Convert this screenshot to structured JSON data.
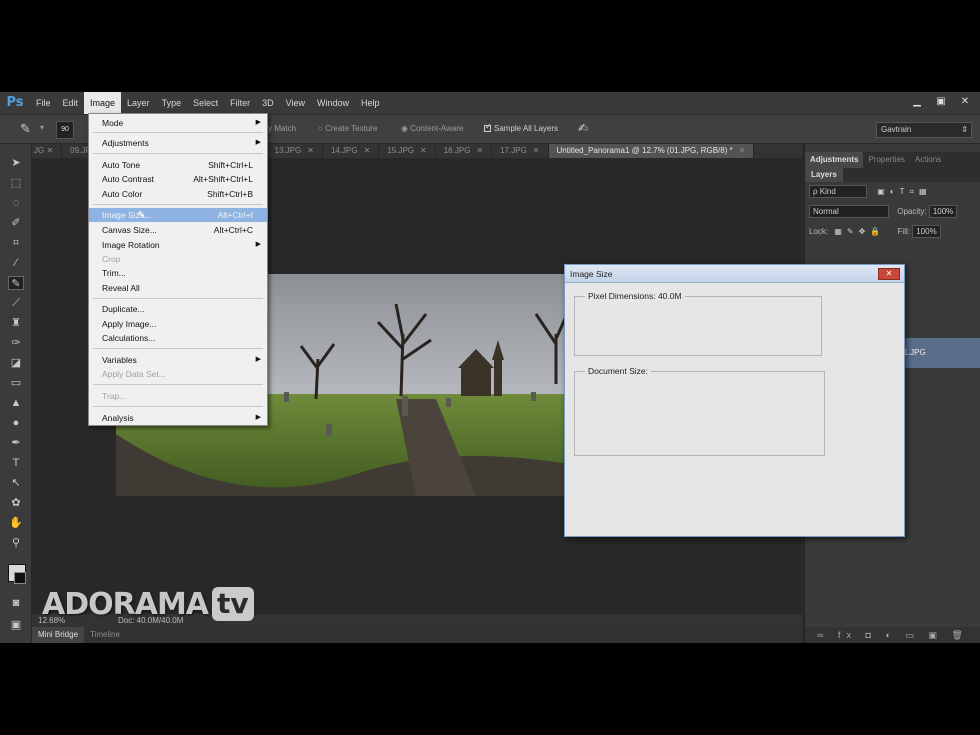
{
  "app": {
    "logo": "Ps"
  },
  "menubar": {
    "items": [
      "File",
      "Edit",
      "Image",
      "Layer",
      "Type",
      "Select",
      "Filter",
      "3D",
      "View",
      "Window",
      "Help"
    ],
    "active_index": 2
  },
  "options": {
    "brush_size": "90",
    "proximity_match": "Proximity Match",
    "create_texture": "Create Texture",
    "content_aware": "Content-Aware",
    "sample_all_layers": "Sample All Layers",
    "workspace": "Gavtrain"
  },
  "doc_tabs": [
    {
      "label": "09.JPG",
      "active": false
    },
    {
      "label": "13.JPG",
      "active": false
    },
    {
      "label": "14.JPG",
      "active": false
    },
    {
      "label": "15.JPG",
      "active": false
    },
    {
      "label": "16.JPG",
      "active": false
    },
    {
      "label": "17.JPG",
      "active": false
    },
    {
      "label": "Untitled_Panorama1 @ 12.7% (01.JPG, RGB/8) *",
      "active": true
    }
  ],
  "image_menu": {
    "items": [
      {
        "label": "Mode",
        "shortcut": "",
        "submenu": true,
        "disabled": false
      },
      {
        "label": "Adjustments",
        "shortcut": "",
        "submenu": true,
        "disabled": false
      },
      {
        "label": "Auto Tone",
        "shortcut": "Shift+Ctrl+L",
        "submenu": false,
        "disabled": false
      },
      {
        "label": "Auto Contrast",
        "shortcut": "Alt+Shift+Ctrl+L",
        "submenu": false,
        "disabled": false
      },
      {
        "label": "Auto Color",
        "shortcut": "Shift+Ctrl+B",
        "submenu": false,
        "disabled": false
      },
      {
        "label": "Image Size...",
        "shortcut": "Alt+Ctrl+I",
        "submenu": false,
        "disabled": false,
        "highlighted": true
      },
      {
        "label": "Canvas Size...",
        "shortcut": "Alt+Ctrl+C",
        "submenu": false,
        "disabled": false
      },
      {
        "label": "Image Rotation",
        "shortcut": "",
        "submenu": true,
        "disabled": false
      },
      {
        "label": "Crop",
        "shortcut": "",
        "submenu": false,
        "disabled": true
      },
      {
        "label": "Trim...",
        "shortcut": "",
        "submenu": false,
        "disabled": false
      },
      {
        "label": "Reveal All",
        "shortcut": "",
        "submenu": false,
        "disabled": false
      },
      {
        "label": "Duplicate...",
        "shortcut": "",
        "submenu": false,
        "disabled": false
      },
      {
        "label": "Apply Image...",
        "shortcut": "",
        "submenu": false,
        "disabled": false
      },
      {
        "label": "Calculations...",
        "shortcut": "",
        "submenu": false,
        "disabled": false
      },
      {
        "label": "Variables",
        "shortcut": "",
        "submenu": true,
        "disabled": false
      },
      {
        "label": "Apply Data Set...",
        "shortcut": "",
        "submenu": false,
        "disabled": true
      },
      {
        "label": "Trap...",
        "shortcut": "",
        "submenu": false,
        "disabled": true
      },
      {
        "label": "Analysis",
        "shortcut": "",
        "submenu": true,
        "disabled": false
      }
    ]
  },
  "dialog": {
    "title": "Image Size",
    "pixel_dimensions_label": "Pixel Dimensions:",
    "pixel_dimensions_value": "40.0M",
    "document_size_label": "Document Size:"
  },
  "status": {
    "zoom": "12.68%",
    "doc": "Doc: 40.0M/40.0M"
  },
  "bottom_tabs": [
    "Mini Bridge",
    "Timeline"
  ],
  "panels": {
    "tabs": [
      "Adjustments",
      "Properties",
      "Actions"
    ],
    "layers_title": "Layers",
    "kind": "ρ Kind",
    "blend_mode": "Normal",
    "opacity_label": "Opacity:",
    "opacity_value": "100%",
    "lock_label": "Lock:",
    "fill_label": "Fill:",
    "fill_value": "100%",
    "layer_name": "01.JPG"
  },
  "watermark": {
    "brand": "ADORAMA",
    "suffix": "tv"
  },
  "colors": {
    "highlight": "#8fb3e2",
    "ps_blue": "#4fa3e0",
    "ui_dark": "#2b2b2b"
  }
}
